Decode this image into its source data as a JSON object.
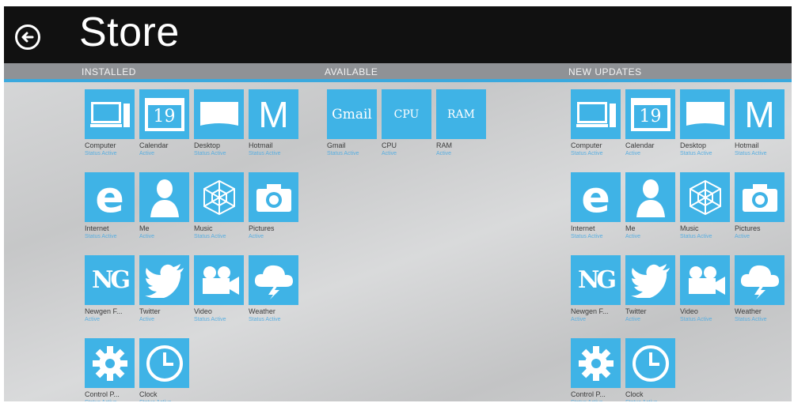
{
  "title": "Store",
  "groups": {
    "installed": {
      "label": "INSTALLED",
      "tiles": [
        {
          "name": "Computer",
          "status": "Status Active",
          "icon": "computer-icon"
        },
        {
          "name": "Calendar",
          "status": "Active",
          "icon": "calendar-icon",
          "glyph": "19"
        },
        {
          "name": "Desktop",
          "status": "Status Active",
          "icon": "desktop-icon"
        },
        {
          "name": "Hotmail",
          "status": "Status Active",
          "icon": "hotmail-icon",
          "glyph": "M"
        },
        {
          "name": "Internet",
          "status": "Status Active",
          "icon": "internet-explorer-icon",
          "glyph": "e"
        },
        {
          "name": "Me",
          "status": "Active",
          "icon": "person-icon"
        },
        {
          "name": "Music",
          "status": "Status Active",
          "icon": "music-icon"
        },
        {
          "name": "Pictures",
          "status": "Active",
          "icon": "camera-icon"
        },
        {
          "name": "Newgen F...",
          "status": "Active",
          "icon": "newgen-icon",
          "glyph": "NG"
        },
        {
          "name": "Twitter",
          "status": "Active",
          "icon": "twitter-bird-icon"
        },
        {
          "name": "Video",
          "status": "Status Active",
          "icon": "video-camera-icon"
        },
        {
          "name": "Weather",
          "status": "Status Active",
          "icon": "weather-icon"
        },
        {
          "name": "Control P...",
          "status": "Status Active",
          "icon": "gear-icon"
        },
        {
          "name": "Clock",
          "status": "Status Active",
          "icon": "clock-icon"
        }
      ]
    },
    "available": {
      "label": "AVAILABLE",
      "tiles": [
        {
          "name": "Gmail",
          "status": "Status Active",
          "icon": "gmail-icon",
          "glyph": "Gmail"
        },
        {
          "name": "CPU",
          "status": "Active",
          "icon": "cpu-icon",
          "glyph": "CPU"
        },
        {
          "name": "RAM",
          "status": "Active",
          "icon": "ram-icon",
          "glyph": "RAM"
        }
      ]
    },
    "updates": {
      "label": "NEW UPDATES",
      "tiles": [
        {
          "name": "Computer",
          "status": "Status Active",
          "icon": "computer-icon"
        },
        {
          "name": "Calendar",
          "status": "Active",
          "icon": "calendar-icon",
          "glyph": "19"
        },
        {
          "name": "Desktop",
          "status": "Status Active",
          "icon": "desktop-icon"
        },
        {
          "name": "Hotmail",
          "status": "Status Active",
          "icon": "hotmail-icon",
          "glyph": "M"
        },
        {
          "name": "Internet",
          "status": "Status Active",
          "icon": "internet-explorer-icon",
          "glyph": "e"
        },
        {
          "name": "Me",
          "status": "Active",
          "icon": "person-icon"
        },
        {
          "name": "Music",
          "status": "Status Active",
          "icon": "music-icon"
        },
        {
          "name": "Pictures",
          "status": "Active",
          "icon": "camera-icon"
        },
        {
          "name": "Newgen F...",
          "status": "Active",
          "icon": "newgen-icon",
          "glyph": "NG"
        },
        {
          "name": "Twitter",
          "status": "Active",
          "icon": "twitter-bird-icon"
        },
        {
          "name": "Video",
          "status": "Status Active",
          "icon": "video-camera-icon"
        },
        {
          "name": "Weather",
          "status": "Status Active",
          "icon": "weather-icon"
        },
        {
          "name": "Control P...",
          "status": "Status Active",
          "icon": "gear-icon"
        },
        {
          "name": "Clock",
          "status": "Status Active",
          "icon": "clock-icon"
        }
      ]
    }
  },
  "colors": {
    "tile": "#3fb3e6",
    "accent": "#3aa9de",
    "topbar": "#111111",
    "status_text": "#59aee0"
  }
}
